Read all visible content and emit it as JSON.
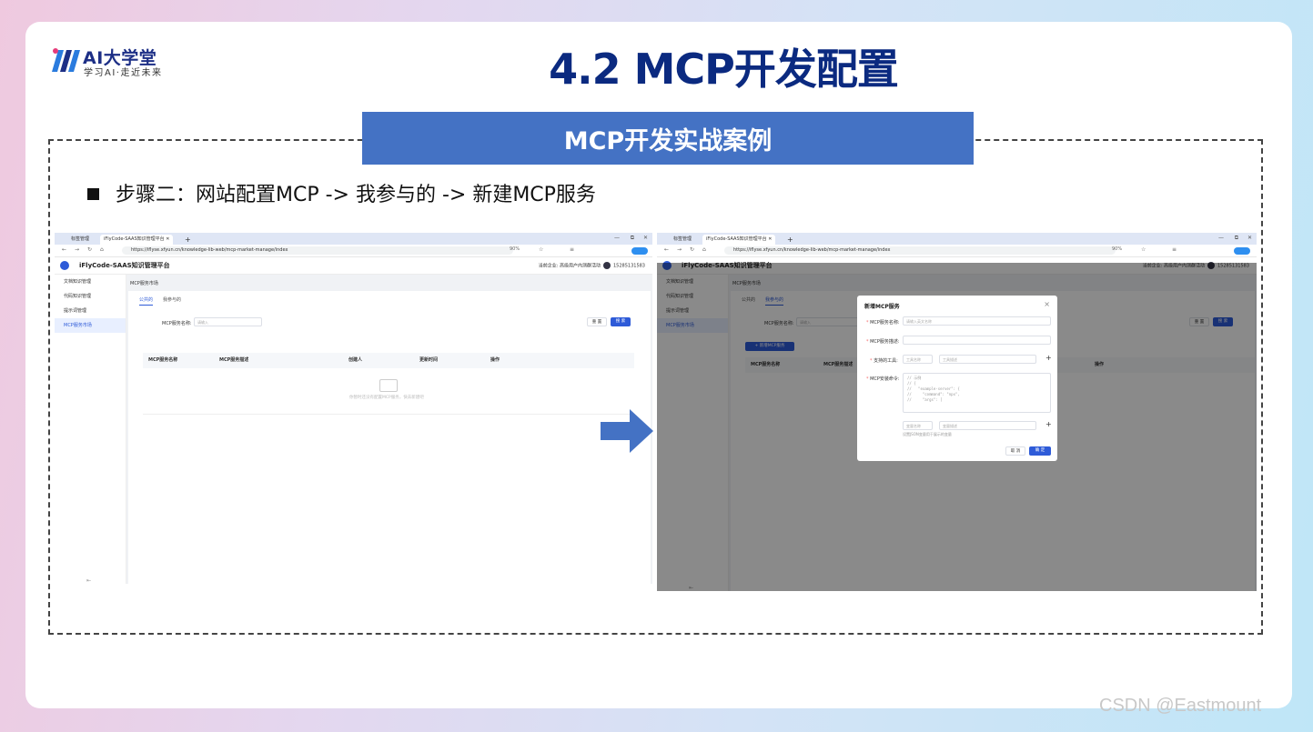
{
  "slide": {
    "title": "4.2 MCP开发配置",
    "banner": "MCP开发实战案例",
    "step": "步骤二：网站配置MCP -> 我参与的 -> 新建MCP服务"
  },
  "logo": {
    "name": "AI大学堂",
    "tagline": "学习AI·走近未来"
  },
  "watermark": "CSDN @Eastmount",
  "colors": {
    "title": "#0b2a80",
    "banner": "#4472c4",
    "accent": "#2e5bd8"
  },
  "browser": {
    "tab_inactive": "标签管理",
    "tab_active": "iFlyCode-SAAS知识管理平台",
    "new_tab": "+",
    "url": "https://iflyse.xfyun.cn/knowledge-lib-web/mcp-market-manage/index",
    "zoom": "90%"
  },
  "app": {
    "title": "iFlyCode-SAAS知识管理平台",
    "enterprise_label": "当前企业:",
    "enterprise": "高级用户内测群活动",
    "phone": "15285131583"
  },
  "sidebar": {
    "items": [
      {
        "label": "文档知识管理"
      },
      {
        "label": "代码知识管理"
      },
      {
        "label": "提示词管理"
      },
      {
        "label": "MCP服务市场"
      }
    ],
    "collapse": "⇤"
  },
  "page": {
    "breadcrumb": "MCP服务市场",
    "tabs": [
      {
        "label": "公共的"
      },
      {
        "label": "我参与的"
      }
    ],
    "search_label": "MCP服务名称:",
    "search_placeholder": "请输入",
    "reset": "重 置",
    "search": "搜 索",
    "new_button": "+ 新增MCP服务",
    "columns": [
      "MCP服务名称",
      "MCP服务描述",
      "创建人",
      "更新时间",
      "操作"
    ],
    "empty_text": "你暂时还没有配置MCP服务，快去新建吧"
  },
  "modal": {
    "title": "新增MCP服务",
    "close": "×",
    "name_label": "MCP服务名称:",
    "name_placeholder": "请输入英文名称",
    "desc_label": "MCP服务描述:",
    "tools_label": "支持的工具:",
    "tool_name_placeholder": "工具名称",
    "tool_desc_placeholder": "工具描述",
    "install_label": "MCP安装命令:",
    "install_code": "// 示例\n// {\n//   \"example-server\": {\n//     \"command\": \"npx\",\n//     \"args\": [",
    "var_name_placeholder": "变量名称",
    "var_desc_placeholder": "变量描述",
    "var_hint": "设置JSON变量用于展示的变量",
    "cancel": "取 消",
    "confirm": "确 定",
    "plus": "+"
  }
}
